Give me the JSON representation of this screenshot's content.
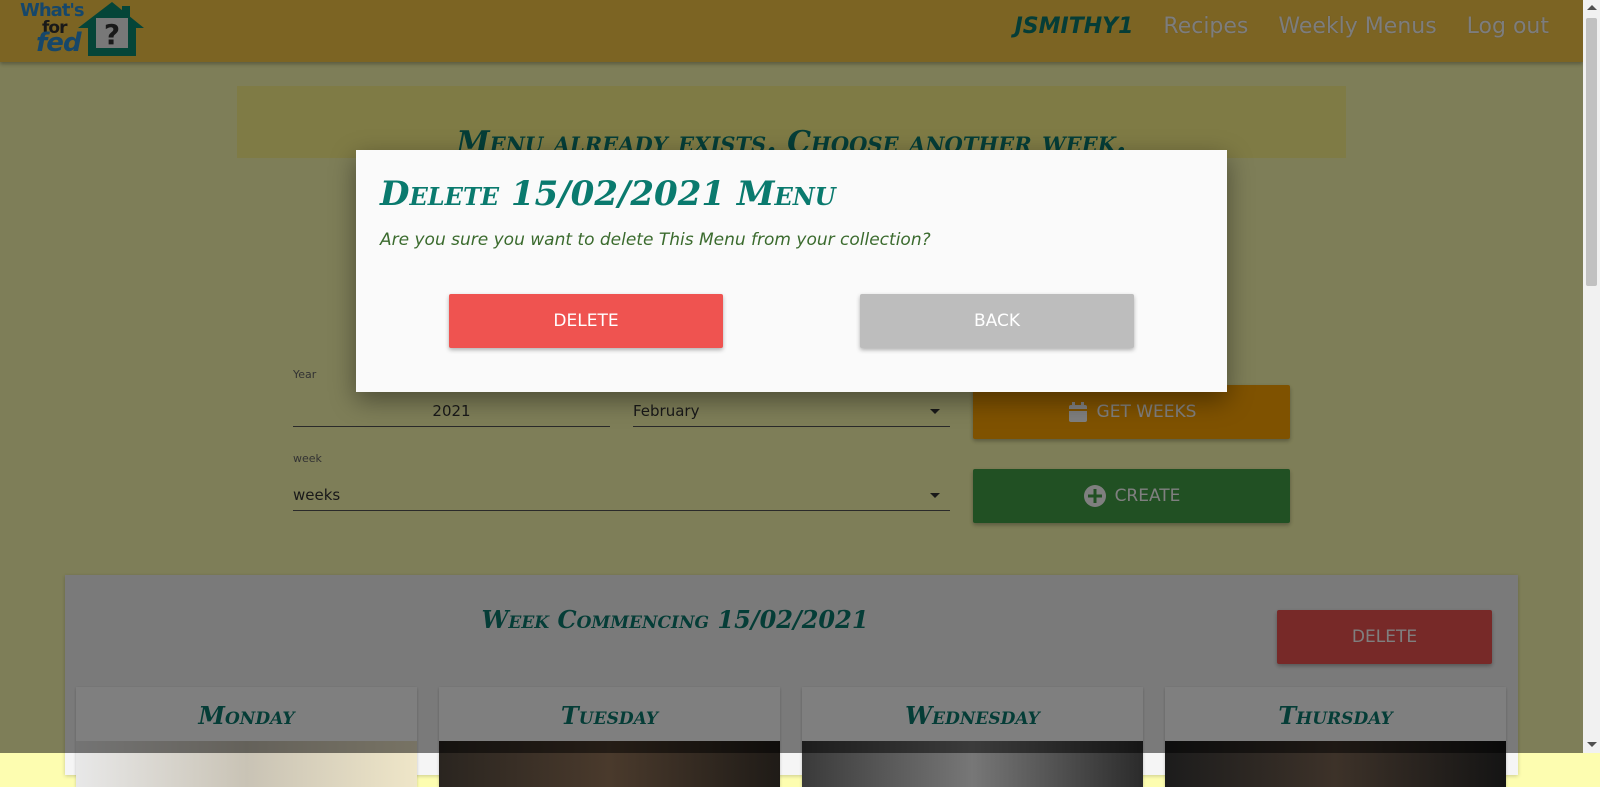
{
  "navbar": {
    "logo": {
      "what": "What's",
      "for": "for",
      "fed": "fed",
      "mark": "?"
    },
    "links": [
      "JSMITHY1",
      "Recipes",
      "Weekly Menus",
      "Log out"
    ]
  },
  "banner": {
    "message": "Menu already exists. Choose another week."
  },
  "form": {
    "year_label": "Year",
    "year_value": "2021",
    "month_value": "February",
    "week_label": "week",
    "week_value": "weeks",
    "get_weeks_label": "GET WEEKS",
    "create_label": "CREATE"
  },
  "week": {
    "title": "Week Commencing 15/02/2021",
    "delete_label": "DELETE",
    "days": [
      "Monday",
      "Tuesday",
      "Wednesday",
      "Thursday"
    ]
  },
  "modal": {
    "title": "Delete 15/02/2021 Menu",
    "text": "Are you sure you want to delete This Menu from your collection?",
    "delete_label": "DELETE",
    "back_label": "BACK"
  },
  "colors": {
    "navbar": "#f9c846",
    "accent_teal": "#0a7a6e",
    "delete_red": "#ef5350",
    "weeks_orange": "#ffa500",
    "create_green": "#43a047"
  }
}
